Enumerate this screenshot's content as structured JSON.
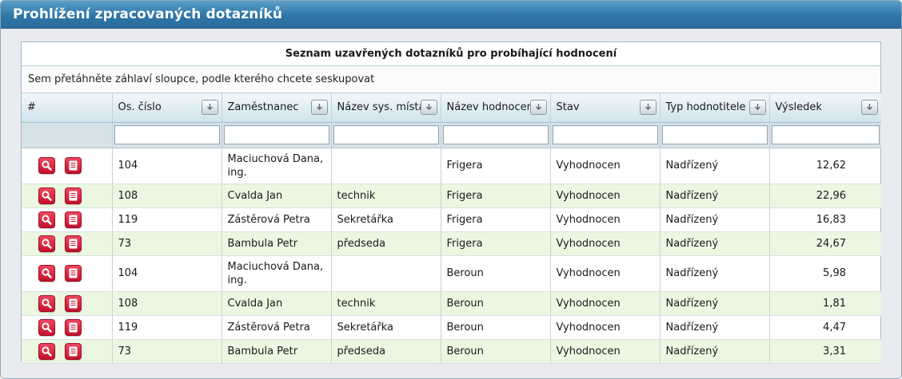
{
  "panel": {
    "title": "Prohlížení zpracovaných dotazníků"
  },
  "grid": {
    "caption": "Seznam uzavřených dotazníků pro probíhající hodnocení",
    "group_hint": "Sem přetáhněte záhlaví sloupce, podle kterého chcete seskupovat",
    "columns": [
      "#",
      "Os. číslo",
      "Zaměstnanec",
      "Název sys. místa",
      "Název hodnocení",
      "Stav",
      "Typ hodnotitele",
      "Výsledek"
    ],
    "filter_placeholders": [
      "",
      "",
      "",
      "",
      "",
      "",
      ""
    ],
    "rows": [
      {
        "os_cislo": "104",
        "zamestnanec": "Maciuchová Dana, ing.",
        "nazev_sys_mista": "",
        "nazev_hodnoceni": "Frigera",
        "stav": "Vyhodnocen",
        "typ_hodnotitele": "Nadřízený",
        "vysledek": "12,62"
      },
      {
        "os_cislo": "108",
        "zamestnanec": "Cvalda Jan",
        "nazev_sys_mista": "technik",
        "nazev_hodnoceni": "Frigera",
        "stav": "Vyhodnocen",
        "typ_hodnotitele": "Nadřízený",
        "vysledek": "22,96"
      },
      {
        "os_cislo": "119",
        "zamestnanec": "Zástěrová Petra",
        "nazev_sys_mista": "Sekretářka",
        "nazev_hodnoceni": "Frigera",
        "stav": "Vyhodnocen",
        "typ_hodnotitele": "Nadřízený",
        "vysledek": "16,83"
      },
      {
        "os_cislo": "73",
        "zamestnanec": "Bambula Petr",
        "nazev_sys_mista": "předseda",
        "nazev_hodnoceni": "Frigera",
        "stav": "Vyhodnocen",
        "typ_hodnotitele": "Nadřízený",
        "vysledek": "24,67"
      },
      {
        "os_cislo": "104",
        "zamestnanec": "Maciuchová Dana, ing.",
        "nazev_sys_mista": "",
        "nazev_hodnoceni": "Beroun",
        "stav": "Vyhodnocen",
        "typ_hodnotitele": "Nadřízený",
        "vysledek": "5,98"
      },
      {
        "os_cislo": "108",
        "zamestnanec": "Cvalda Jan",
        "nazev_sys_mista": "technik",
        "nazev_hodnoceni": "Beroun",
        "stav": "Vyhodnocen",
        "typ_hodnotitele": "Nadřízený",
        "vysledek": "1,81"
      },
      {
        "os_cislo": "119",
        "zamestnanec": "Zástěrová Petra",
        "nazev_sys_mista": "Sekretářka",
        "nazev_hodnoceni": "Beroun",
        "stav": "Vyhodnocen",
        "typ_hodnotitele": "Nadřízený",
        "vysledek": "4,47"
      },
      {
        "os_cislo": "73",
        "zamestnanec": "Bambula Petr",
        "nazev_sys_mista": "předseda",
        "nazev_hodnoceni": "Beroun",
        "stav": "Vyhodnocen",
        "typ_hodnotitele": "Nadřízený",
        "vysledek": "3,31"
      }
    ],
    "row_icons": [
      "magnifier-icon",
      "document-icon"
    ]
  },
  "colors": {
    "header_blue": "#2e76a8",
    "row_alt_green": "#ecf7e1",
    "action_red": "#d4152f"
  }
}
